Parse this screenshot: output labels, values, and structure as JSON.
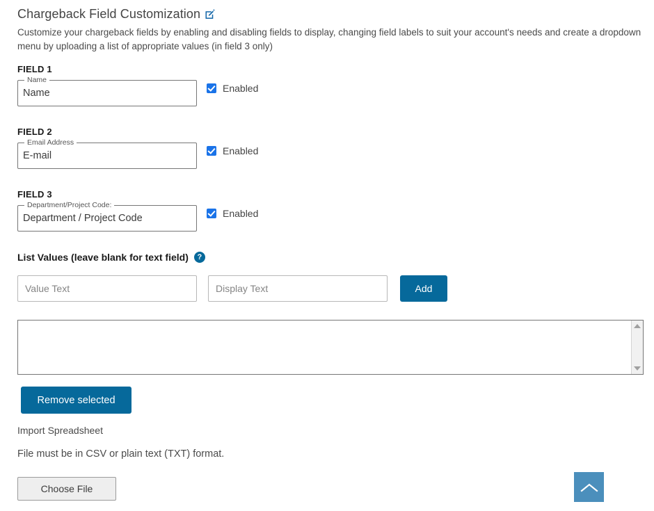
{
  "header": {
    "title": "Chargeback Field Customization",
    "edit_icon": "edit-pencil-square-icon",
    "description": "Customize your chargeback fields by enabling and disabling fields to display, changing field labels to suit your account's needs and create a dropdown menu by uploading a list of appropriate values (in field 3 only)"
  },
  "fields": [
    {
      "legend": "FIELD 1",
      "float_label": "Name",
      "value": "Name",
      "checkbox_label": "Enabled",
      "checked": true
    },
    {
      "legend": "FIELD 2",
      "float_label": "Email Address",
      "value": "E-mail",
      "checkbox_label": "Enabled",
      "checked": true
    },
    {
      "legend": "FIELD 3",
      "float_label": "Department/Project Code:",
      "value": "Department / Project Code",
      "checkbox_label": "Enabled",
      "checked": true
    }
  ],
  "list_values": {
    "heading": "List Values (leave blank for text field)",
    "help_icon": "help-question-icon",
    "help_glyph": "?",
    "value_text_placeholder": "Value Text",
    "value_text_value": "",
    "display_text_placeholder": "Display Text",
    "display_text_value": "",
    "add_label": "Add",
    "listbox_items": [],
    "remove_label": "Remove selected"
  },
  "import": {
    "label": "Import Spreadsheet",
    "note": "File must be in CSV or plain text (TXT) format.",
    "choose_file_label": "Choose File"
  },
  "scroll_top": {
    "icon": "chevron-up-icon"
  },
  "colors": {
    "primary_blue": "#06699b",
    "checkbox_blue": "#1a73e8",
    "scroll_top_blue": "#4b8fbc",
    "text": "#444444"
  }
}
